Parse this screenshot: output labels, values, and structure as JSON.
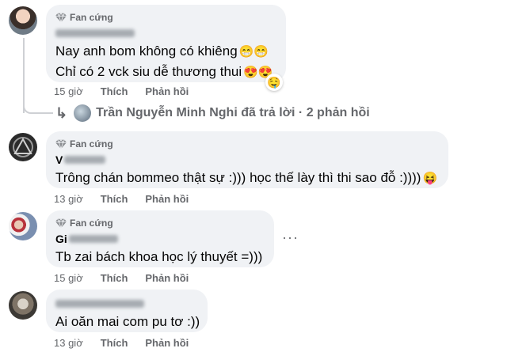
{
  "comments": [
    {
      "badge": "Fan cứng",
      "name": "",
      "lines": [
        "Nay anh bom không có khiêng",
        "Chỉ có 2 vck siu dễ thương thui"
      ],
      "line_emoji": [
        "😁😁",
        "😍😍"
      ],
      "reaction": "🤤",
      "time": "15 giờ",
      "like": "Thích",
      "reply": "Phản hồi"
    },
    {
      "badge": "Fan cứng",
      "name": "V",
      "lines": [
        "Trông chán bommeo thật sự :))) học thế lày thì thi sao đỗ :))))"
      ],
      "line_emoji": [
        "😝"
      ],
      "time": "13 giờ",
      "like": "Thích",
      "reply": "Phản hồi"
    },
    {
      "badge": "Fan cứng",
      "name": "Gi",
      "lines": [
        "Tb zai bách khoa học lý thuyết =)))"
      ],
      "time": "15 giờ",
      "like": "Thích",
      "reply": "Phản hồi",
      "more": "···"
    },
    {
      "name": "",
      "lines": [
        "Ai oăn mai com pu tơ :))"
      ],
      "time": "13 giờ",
      "like": "Thích",
      "reply": "Phản hồi"
    }
  ],
  "replies_summary": {
    "arrow": "↳",
    "text": "Trần Nguyễn Minh Nghi đã trả lời · 2 phản hồi"
  }
}
